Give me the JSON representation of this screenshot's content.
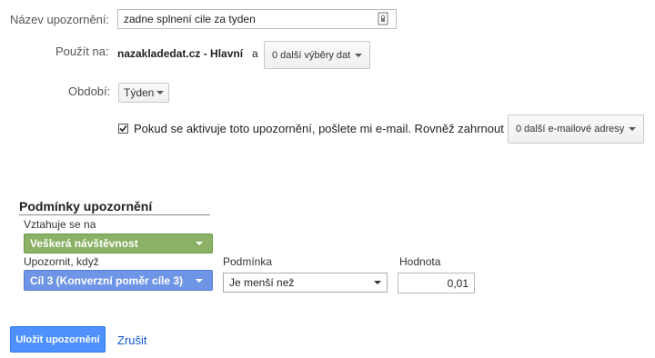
{
  "alert_name": {
    "label": "Název upozornění:",
    "value": "zadne splnení cile za tyden"
  },
  "apply_to": {
    "label": "Použít na:",
    "property": "nazakladedat.cz - Hlavní",
    "conjunction": "a",
    "views_dropdown": "0 další výběry dat"
  },
  "period": {
    "label": "Období:",
    "value": "Týden"
  },
  "email": {
    "checked": true,
    "text": "Pokud se aktivuje toto upozornění, pošlete mi e-mail. Rovněž zahrnout",
    "other_emails_dropdown": "0 další e-mailové adresy"
  },
  "conditions": {
    "heading": "Podmínky upozornění",
    "applies_to_label": "Vztahuje se na",
    "applies_to_value": "Veškerá návštěvnost",
    "alert_when_label": "Upozornit, když",
    "alert_when_value": "Cíl 3 (Konverzní poměr cíle 3)",
    "condition_label": "Podmínka",
    "condition_value": "Je menší než",
    "value_label": "Hodnota",
    "value": "0,01"
  },
  "actions": {
    "save": "Uložit upozornění",
    "cancel": "Zrušit"
  },
  "colors": {
    "green_pill": "#8ab166",
    "blue_pill": "#6f95e6",
    "save_button": "#4d90fe",
    "link": "#1155cc"
  },
  "icons": {
    "name_field_icon": "document-lock-icon",
    "checkbox_mark": "checkmark-icon"
  }
}
